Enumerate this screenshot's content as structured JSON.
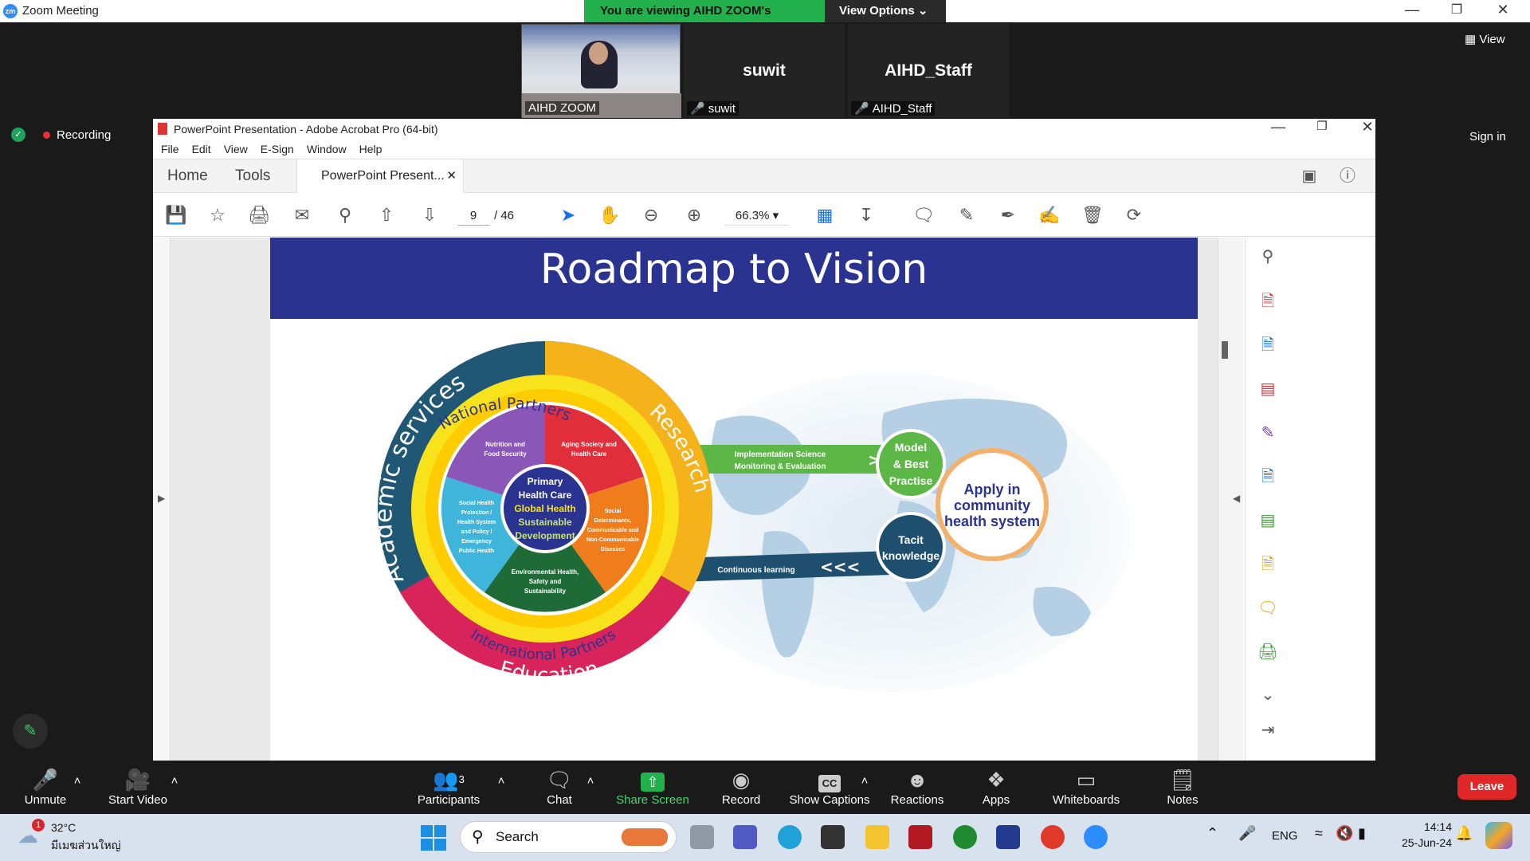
{
  "zoom": {
    "window_title": "Zoom Meeting",
    "banner_text": "You are viewing AIHD ZOOM's screen",
    "view_options": "View Options",
    "view_button": "View",
    "recording": "Recording",
    "sign_in": "Sign in",
    "participants_tiles": [
      {
        "display": "",
        "label": "AIHD ZOOM"
      },
      {
        "display": "suwit",
        "label": "suwit"
      },
      {
        "display": "AIHD_Staff",
        "label": "AIHD_Staff"
      }
    ],
    "toolbar": {
      "unmute": "Unmute",
      "start_video": "Start Video",
      "participants": "Participants",
      "participant_count": "3",
      "chat": "Chat",
      "share_screen": "Share Screen",
      "record": "Record",
      "show_captions": "Show Captions",
      "reactions": "Reactions",
      "apps": "Apps",
      "whiteboards": "Whiteboards",
      "notes": "Notes",
      "leave": "Leave"
    }
  },
  "acrobat": {
    "title": "PowerPoint Presentation - Adobe Acrobat Pro (64-bit)",
    "menu": [
      "File",
      "Edit",
      "View",
      "E-Sign",
      "Window",
      "Help"
    ],
    "tabs": {
      "home": "Home",
      "tools": "Tools",
      "document": "PowerPoint Present..."
    },
    "page_current": "9",
    "page_total": "/ 46",
    "zoom": "66.3%"
  },
  "slide": {
    "title": "Roadmap to Vision",
    "outer_ring": {
      "left": "Academic services",
      "right": "Research",
      "bottom": "Education"
    },
    "middle_ring": {
      "top": "National Partners",
      "bottom": "International Partners"
    },
    "segments": [
      "Nutrition and Food Security",
      "Aging Society and Health Care",
      "Social Determinants, Communicable and Non-Communicable Diseases",
      "Environmental Health, Safety and Sustainability",
      "Social Health Protection / Health System and Policy / Emergency Public Health"
    ],
    "center": {
      "line1": "Primary",
      "line2": "Health Care",
      "line3": "Global Health",
      "line4": "Sustainable",
      "line5": "Development"
    },
    "arrow_top": {
      "line1": "Implementation Science",
      "line2": "Monitoring & Evaluation"
    },
    "arrow_bottom": "Continuous learning",
    "circle_model": {
      "line1": "Model",
      "line2": "& Best",
      "line3": "Practise"
    },
    "circle_tacit": {
      "line1": "Tacit",
      "line2": "knowledge"
    },
    "circle_apply": {
      "line1": "Apply in",
      "line2": "community",
      "line3": "health system"
    }
  },
  "taskbar": {
    "temperature": "32°C",
    "weather_location": "มีเมฆส่วนใหญ่",
    "weather_badge": "1",
    "search": "Search",
    "language": "ENG",
    "time": "14:14",
    "date": "25-Jun-24"
  }
}
